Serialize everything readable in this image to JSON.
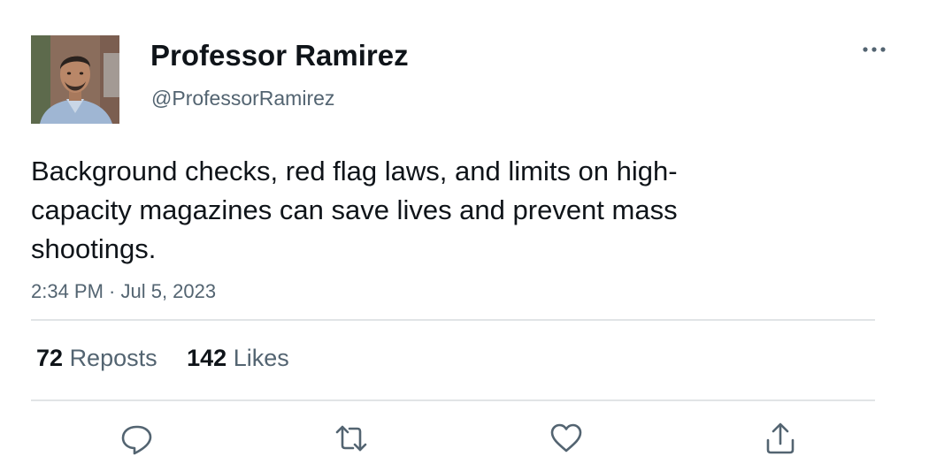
{
  "author": {
    "display_name": "Professor Ramirez",
    "handle": "@ProfessorRamirez"
  },
  "tweet": {
    "text": "Background checks, red flag laws, and limits on high-\ncapacity magazines can save lives and prevent mass\nshootings.",
    "timestamp": "2:34 PM · Jul 5, 2023"
  },
  "stats": {
    "reposts_count": "72",
    "reposts_label": "Reposts",
    "likes_count": "142",
    "likes_label": "Likes"
  },
  "icons": {
    "more": "more-options-icon",
    "reply": "reply-icon",
    "repost": "repost-icon",
    "like": "heart-icon",
    "share": "share-icon"
  },
  "colors": {
    "text_primary": "#0f1419",
    "text_secondary": "#536471",
    "divider": "#e1e4e6",
    "icon": "#536471"
  }
}
